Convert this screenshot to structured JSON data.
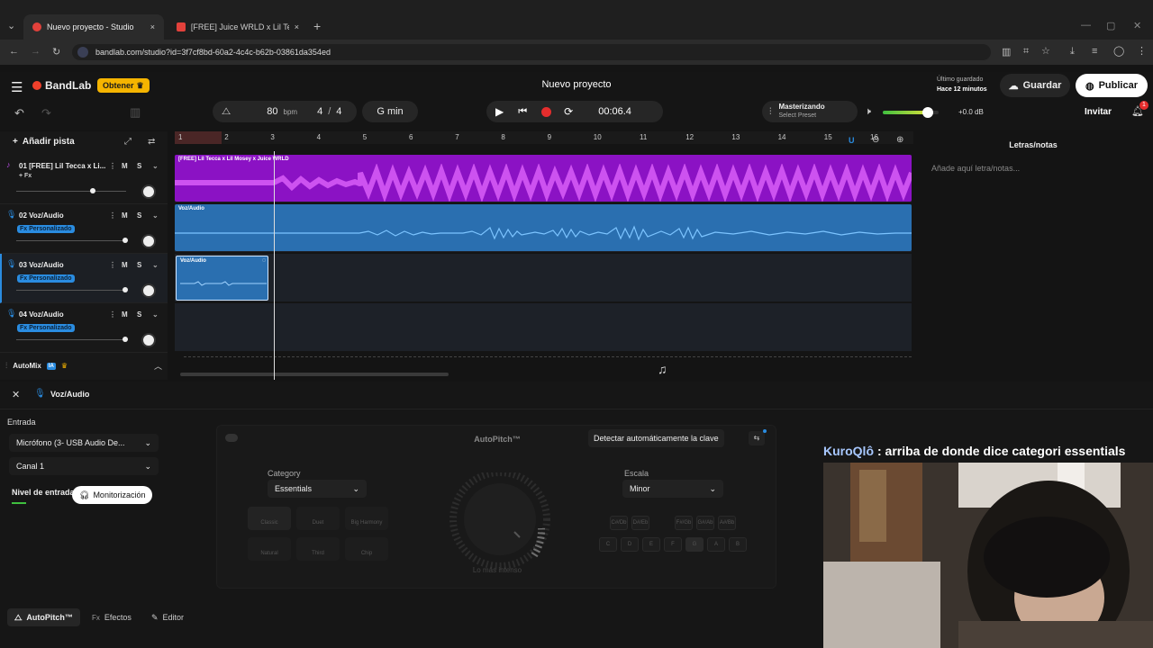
{
  "browser": {
    "tabs": [
      {
        "label": "Nuevo proyecto - Studio"
      },
      {
        "label": "[FREE] Juice WRLD x Lil Tecca Ty"
      }
    ],
    "url": "bandlab.com/studio?id=3f7cf8bd-60a2-4c4c-b62b-03861da354ed"
  },
  "header": {
    "logo": "BandLab",
    "upgrade": "Obtener",
    "project_title": "Nuevo proyecto",
    "last_saved_label": "Último guardado",
    "last_saved_time": "Hace 12 minutos",
    "save": "Guardar",
    "publish": "Publicar",
    "invite": "Invitar",
    "notif_count": "1"
  },
  "transport": {
    "tempo": "80",
    "tempo_unit": "bpm",
    "sig_num": "4",
    "sig_sep": "/",
    "sig_den": "4",
    "key": "G min",
    "time": "00:06.4",
    "mastering_label": "Masterizando",
    "mastering_preset": "Select Preset",
    "master_volume_db": "+0.0 dB",
    "master_volume_level": 0.8
  },
  "tracks_panel": {
    "add_track": "Añadir pista",
    "mute": "M",
    "solo": "S",
    "tracks": [
      {
        "name": "01  [FREE] Lil Tecca x Li...",
        "fx": "+ Fx",
        "fx_active": false,
        "volume": 0.7
      },
      {
        "name": "02  Voz/Audio",
        "fx": "Fx Personalizado",
        "fx_active": true,
        "volume": 0.99
      },
      {
        "name": "03  Voz/Audio",
        "fx": "Fx Personalizado",
        "fx_active": true,
        "volume": 0.99
      },
      {
        "name": "04  Voz/Audio",
        "fx": "Fx Personalizado",
        "fx_active": true,
        "volume": 0.99
      }
    ],
    "automix": "AutoMix",
    "automix_badge": "IA"
  },
  "timeline": {
    "bars": [
      "1",
      "2",
      "3",
      "4",
      "5",
      "6",
      "7",
      "8",
      "9",
      "10",
      "11",
      "12",
      "13",
      "14",
      "15",
      "16"
    ],
    "clips": [
      {
        "label": "[FREE] Lil Tecca x Lil Mosey x Juice WRLD"
      },
      {
        "label": "Voz/Audio"
      },
      {
        "label": "Voz/Audio"
      }
    ]
  },
  "lyrics": {
    "title": "Letras/notas",
    "placeholder": "Añade aquí letra/notas..."
  },
  "editor": {
    "track_title": "Voz/Audio",
    "input_label": "Entrada",
    "input_device": "Micrófono (3- USB Audio De...",
    "channel": "Canal 1",
    "level_label": "Nivel de entrada",
    "monitor": "Monitorización",
    "autopitch_title": "AutoPitch™",
    "detect_key": "Detectar automáticamente la clave",
    "category_label": "Category",
    "category_value": "Essentials",
    "scale_label": "Escala",
    "scale_value": "Minor",
    "styles": [
      "Classic",
      "Duet",
      "Big Harmony",
      "Natural",
      "Third",
      "Chip"
    ],
    "knob_caption": "Lo más intenso",
    "notes_top": [
      "C#/Db",
      "D#/Eb",
      "F#/Gb",
      "G#/Ab",
      "A#/Bb"
    ],
    "notes_bottom": [
      "C",
      "D",
      "E",
      "F",
      "G",
      "A",
      "B"
    ],
    "bottom_tabs": [
      "AutoPitch™",
      "Efectos",
      "Editor"
    ]
  },
  "stream": {
    "chat_user": "KuroQlô",
    "chat_message": ": arriba de donde dice categori essentials"
  }
}
